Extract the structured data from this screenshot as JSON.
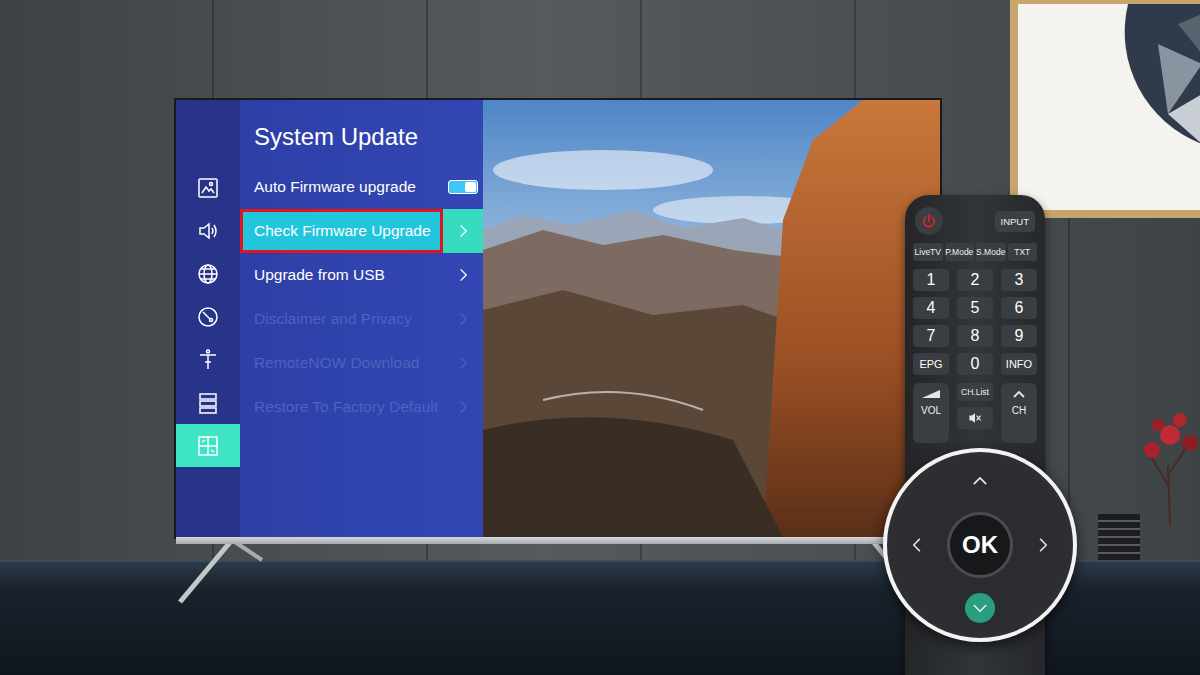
{
  "tv_menu": {
    "title": "System Update",
    "sidebar": [
      {
        "kind": "picture",
        "selected": false
      },
      {
        "kind": "sound",
        "selected": false
      },
      {
        "kind": "network",
        "selected": false
      },
      {
        "kind": "channel",
        "selected": false
      },
      {
        "kind": "accessibility",
        "selected": false
      },
      {
        "kind": "system",
        "selected": false
      },
      {
        "kind": "support",
        "selected": true
      }
    ],
    "items": [
      {
        "label": "Auto Firmware upgrade",
        "kind": "toggle",
        "on": true,
        "selected": false,
        "disabled": false,
        "annotated": false
      },
      {
        "label": "Check Firmware Upgrade",
        "kind": "link",
        "selected": true,
        "disabled": false,
        "annotated": true
      },
      {
        "label": "Upgrade from USB",
        "kind": "link",
        "selected": false,
        "disabled": false,
        "annotated": false
      },
      {
        "label": "Disclaimer and Privacy",
        "kind": "link",
        "selected": false,
        "disabled": true,
        "annotated": false
      },
      {
        "label": "RemoteNOW Download",
        "kind": "link",
        "selected": false,
        "disabled": true,
        "annotated": false
      },
      {
        "label": "Restore To Factory Default",
        "kind": "link",
        "selected": false,
        "disabled": true,
        "annotated": false
      }
    ]
  },
  "remote": {
    "input": "INPUT",
    "modes": [
      "LiveTV",
      "P.Mode",
      "S.Mode",
      "TXT"
    ],
    "keypad": [
      "1",
      "2",
      "3",
      "4",
      "5",
      "6",
      "7",
      "8",
      "9",
      "EPG",
      "0",
      "INFO"
    ],
    "volume": "VOL",
    "channel_list": "CH.List",
    "channel": "CH"
  },
  "dpad": {
    "label": "OK",
    "arrows": [
      {
        "kind": "up",
        "selected": false
      },
      {
        "kind": "left",
        "selected": false
      },
      {
        "kind": "right",
        "selected": false
      },
      {
        "kind": "down",
        "selected": true
      }
    ]
  }
}
